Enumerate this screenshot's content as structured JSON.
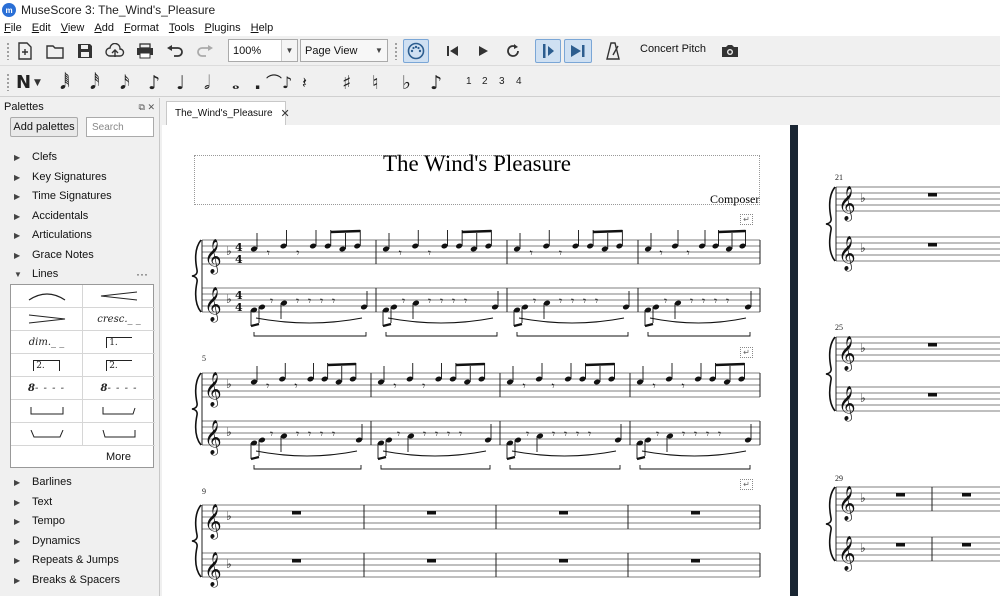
{
  "window": {
    "title": "MuseScore 3: The_Wind's_Pleasure",
    "app_icon_text": "m"
  },
  "menu": [
    "File",
    "Edit",
    "View",
    "Add",
    "Format",
    "Tools",
    "Plugins",
    "Help"
  ],
  "toolbar": {
    "zoom": "100%",
    "view_mode": "Page View",
    "concert_pitch_label": "Concert Pitch",
    "icons": [
      "new-file-icon",
      "open-folder-icon",
      "save-icon",
      "upload-cloud-icon",
      "print-icon",
      "undo-icon",
      "redo-icon",
      "midi-input-icon",
      "rewind-icon",
      "play-icon",
      "loop-icon",
      "playback-start-icon",
      "pan-score-icon",
      "metronome-icon",
      "screenshot-icon"
    ]
  },
  "note_input": {
    "mode_glyph": "N",
    "durations": [
      "64th",
      "32nd",
      "16th",
      "eighth",
      "quarter",
      "half",
      "whole",
      "augmentation-dot"
    ],
    "voices": [
      "1",
      "2",
      "3",
      "4"
    ],
    "glyphs": {
      "n64": "𝅘𝅥𝅱",
      "n32": "𝅘𝅥𝅰",
      "n16": "𝅘𝅥𝅯",
      "n8": "♪",
      "n4": "♩",
      "n2": "𝅗𝅥",
      "n1": "𝅝",
      "dot": ".",
      "tie": "⌒♪",
      "rest": "𝄽",
      "sharp": "♯",
      "natural": "♮",
      "flat": "♭",
      "flip": "♪"
    }
  },
  "palettes": {
    "title": "Palettes",
    "add_button": "Add palettes",
    "search_placeholder": "Search",
    "items_top": [
      "Clefs",
      "Key Signatures",
      "Time Signatures",
      "Accidentals",
      "Articulations",
      "Grace Notes"
    ],
    "expanded": "Lines",
    "lines_cells": [
      "",
      "",
      "",
      "cresc.",
      "dim.",
      "1.",
      "2.",
      "2.",
      "8",
      "8",
      "",
      "",
      "",
      ""
    ],
    "more_label": "More",
    "items_bottom": [
      "Barlines",
      "Text",
      "Tempo",
      "Dynamics",
      "Repeats & Jumps",
      "Breaks & Spacers"
    ]
  },
  "tab": {
    "label": "The_Wind's_Pleasure"
  },
  "score": {
    "title": "The Wind's Pleasure",
    "composer": "Composer",
    "key": "F major (1 flat)",
    "time_signature": "4/4",
    "measure_numbers": [
      "5",
      "9",
      "21",
      "25",
      "29"
    ]
  }
}
